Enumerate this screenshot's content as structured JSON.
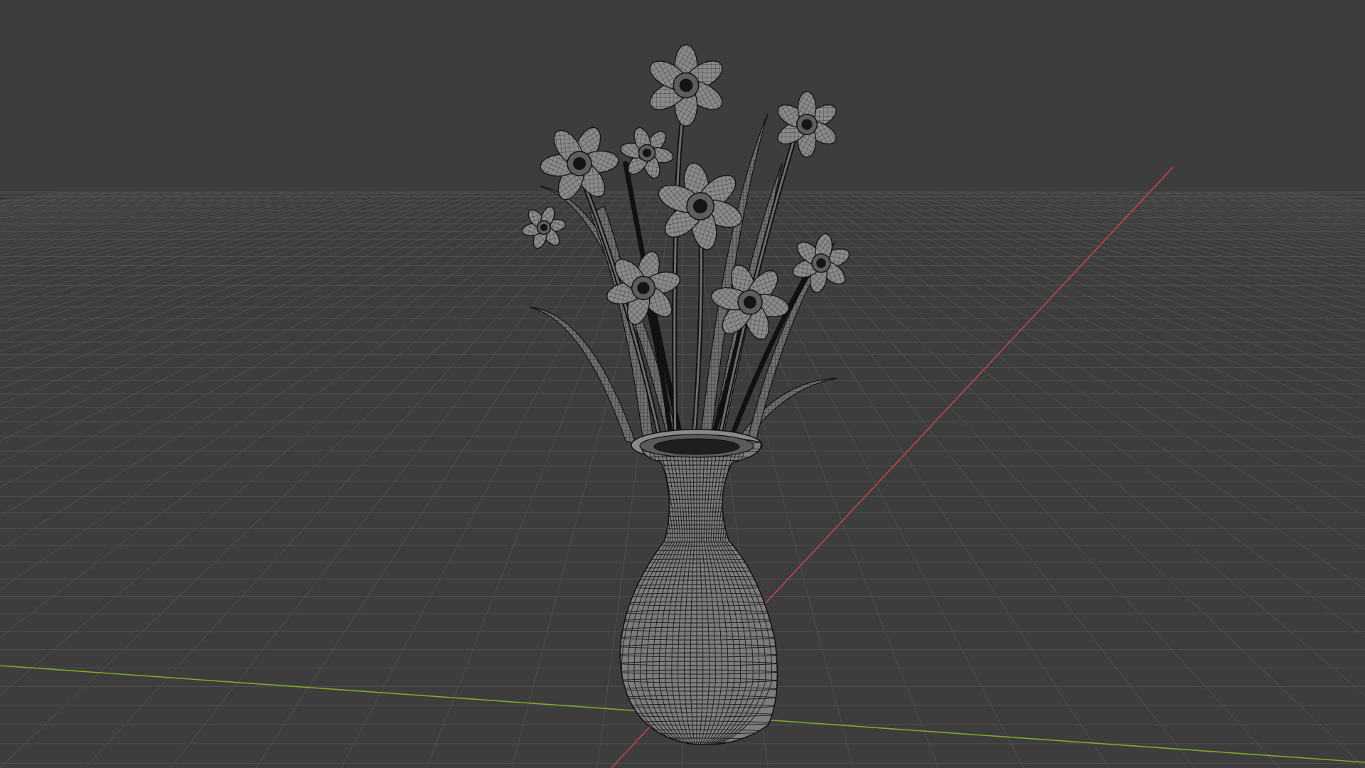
{
  "viewport": {
    "kind": "3d-viewport",
    "shading": "wireframe-overlay",
    "background_color": "#3d3d3d",
    "grid_line_color": "#4f4f4f",
    "x_axis_color": "#c4444e",
    "y_axis_color": "#7eaa2c",
    "mesh_fill_color": "#7a7a7a",
    "mesh_wire_color": "#161616"
  },
  "scene": {
    "objects": [
      {
        "name": "vase",
        "icon": "vase-mesh"
      },
      {
        "name": "daffodil-bouquet",
        "icon": "flower-mesh",
        "flower_count": 9
      }
    ]
  }
}
